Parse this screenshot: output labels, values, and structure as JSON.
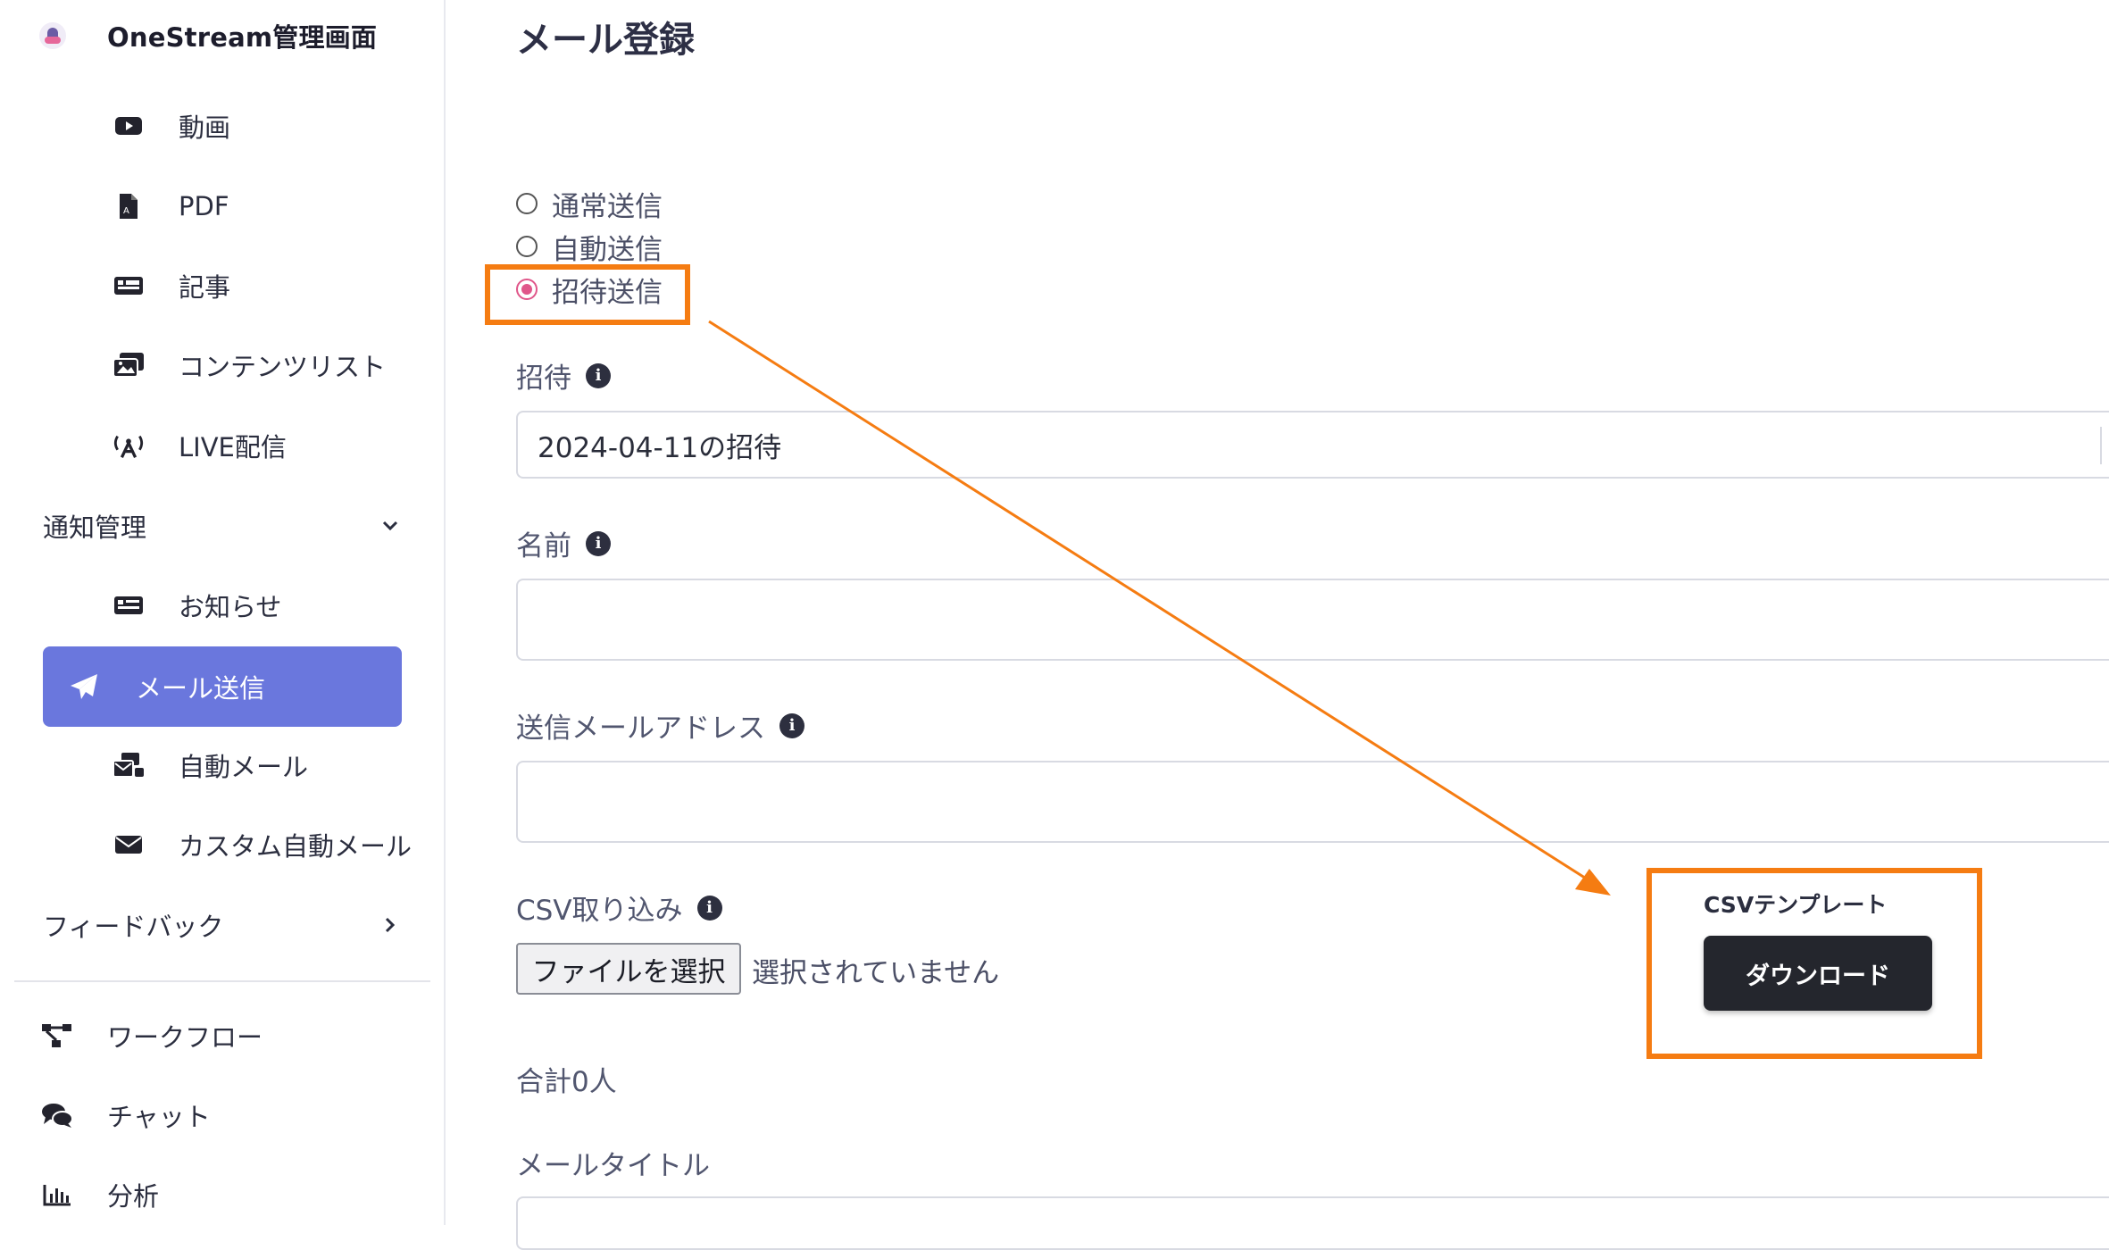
{
  "sidebar": {
    "brand": "OneStream管理画面",
    "content_items": [
      {
        "label": "動画",
        "icon": "video-icon"
      },
      {
        "label": "PDF",
        "icon": "pdf-file-icon"
      },
      {
        "label": "記事",
        "icon": "article-icon"
      },
      {
        "label": "コンテンツリスト",
        "icon": "images-icon"
      },
      {
        "label": "LIVE配信",
        "icon": "broadcast-tower-icon"
      }
    ],
    "notification_group": {
      "label": "通知管理",
      "state": "expanded"
    },
    "notification_items": [
      {
        "label": "お知らせ",
        "icon": "newspaper-icon"
      },
      {
        "label": "メール送信",
        "icon": "paper-plane-icon",
        "active": true
      },
      {
        "label": "自動メール",
        "icon": "mail-bulk-icon"
      },
      {
        "label": "カスタム自動メール",
        "icon": "envelope-icon"
      }
    ],
    "feedback_group": {
      "label": "フィードバック",
      "state": "collapsed"
    },
    "bottom_items": [
      {
        "label": "ワークフロー",
        "icon": "workflow-icon"
      },
      {
        "label": "チャット",
        "icon": "chat-icon"
      },
      {
        "label": "分析",
        "icon": "chart-icon"
      }
    ]
  },
  "main": {
    "title": "メール登録",
    "send_types": [
      {
        "label": "通常送信",
        "checked": false
      },
      {
        "label": "自動送信",
        "checked": false
      },
      {
        "label": "招待送信",
        "checked": true
      }
    ],
    "invite": {
      "label": "招待",
      "value": "2024-04-11の招待"
    },
    "name": {
      "label": "名前",
      "value": ""
    },
    "sender_address": {
      "label": "送信メールアドレス",
      "value": ""
    },
    "csv_import": {
      "label": "CSV取り込み",
      "button": "ファイルを選択",
      "status": "選択されていません"
    },
    "csv_template": {
      "label": "CSVテンプレート",
      "button": "ダウンロード"
    },
    "total": "合計0人",
    "mail_title": {
      "label": "メールタイトル"
    }
  },
  "annotation": {
    "color": "#f57c12"
  },
  "colors": {
    "accent": "#6a77dd",
    "radio_checked": "#e0568a"
  }
}
